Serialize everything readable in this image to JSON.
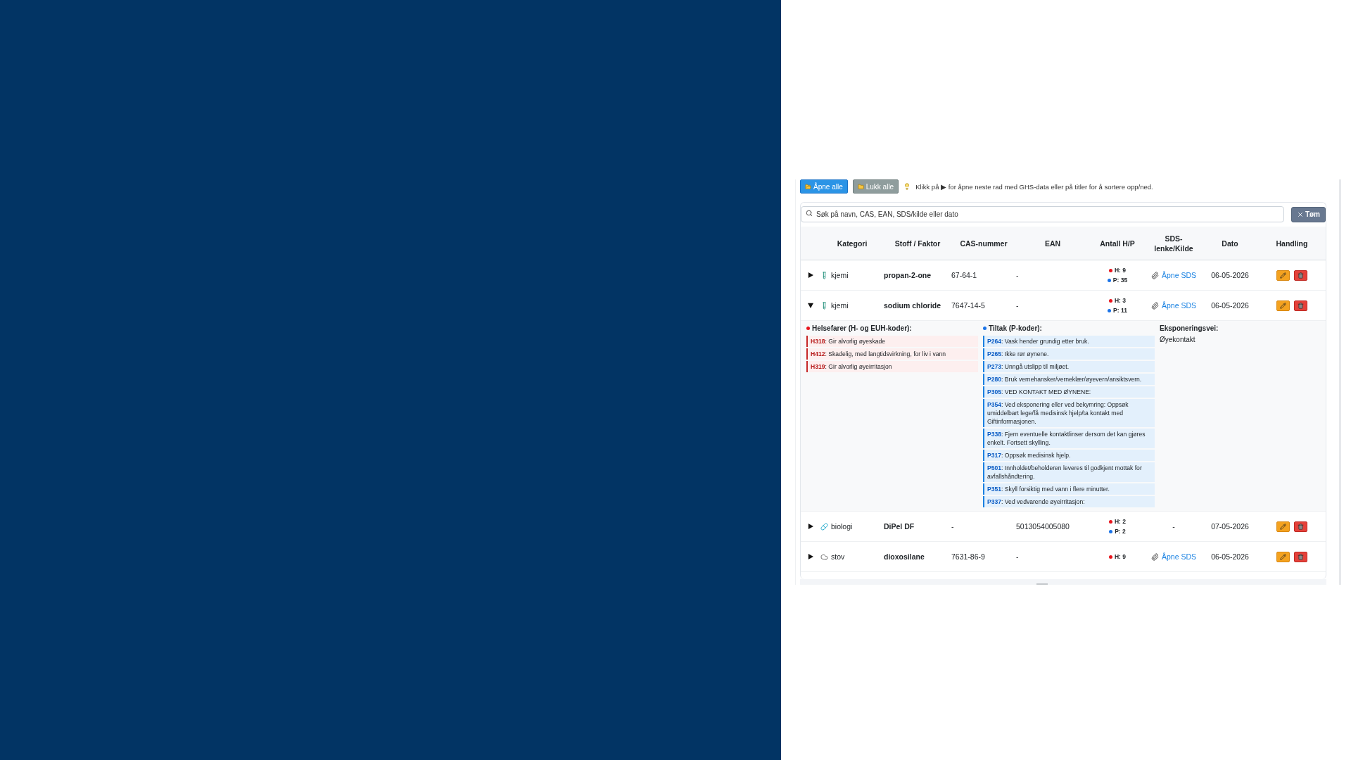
{
  "toolbar": {
    "open_all": "Åpne alle",
    "close_all": "Lukk alle",
    "hint": "Klikk på ▶ for åpne neste rad med GHS-data eller på titler for å sortere opp/ned."
  },
  "search": {
    "placeholder": "Søk på navn, CAS, EAN, SDS/kilde eller dato",
    "clear": "Tøm"
  },
  "table": {
    "columns": [
      "Kategori",
      "Stoff / Faktor",
      "CAS-nummer",
      "EAN",
      "Antall H/P",
      "SDS-lenke/Kilde",
      "Dato",
      "Handling"
    ],
    "rows": [
      {
        "expanded": false,
        "kind": "chemical",
        "category": "kjemi",
        "name": "propan-2-one",
        "cas": "67-64-1",
        "ean": "-",
        "h": "H: 9",
        "p": "P: 35",
        "sds_link": "Åpne SDS",
        "date": "06-05-2026"
      },
      {
        "expanded": true,
        "kind": "chemical",
        "category": "kjemi",
        "name": "sodium chloride",
        "cas": "7647-14-5",
        "ean": "-",
        "h": "H: 3",
        "p": "P: 11",
        "sds_link": "Åpne SDS",
        "date": "06-05-2026",
        "details": {
          "hazards_title": "Helsefarer (H- og EUH-koder):",
          "hazards": [
            "**H318**: Gir alvorlig øyeskade",
            "**H412**: Skadelig, med langtidsvirkning, for liv i vann",
            "**H319**: Gir alvorlig øyeirritasjon"
          ],
          "measures_title": "Tiltak (P-koder):",
          "measures": [
            "**P264**: Vask hender grundig etter bruk.",
            "**P265**: Ikke rør øynene.",
            "**P273**: Unngå utslipp til miljøet.",
            "**P280**: Bruk vernehansker/verneklær/øyevern/ansiktsvern.",
            "**P305**: VED KONTAKT MED ØYNENE:",
            "**P354**: Ved eksponering eller ved bekymring: Oppsøk umiddelbart lege/få medisinsk hjelp/ta kontakt med Giftinformasjonen.",
            "**P338**: Fjern eventuelle kontaktlinser dersom det kan gjøres enkelt. Fortsett skylling.",
            "**P317**: Oppsøk medisinsk hjelp.",
            "**P501**: Innholdet/beholderen leveres til godkjent mottak for avfallshåndtering.",
            "**P351**: Skyll forsiktig med vann i flere minutter.",
            "**P337**: Ved vedvarende øyeirritasjon:"
          ],
          "exposure_title": "Eksponeringsvei:",
          "exposure": "Øyekontakt"
        }
      },
      {
        "expanded": false,
        "kind": "biological",
        "category": "biologi",
        "name": "DiPel DF",
        "cas": "-",
        "ean": "5013054005080",
        "h": "H: 2",
        "p": "P: 2",
        "sds": "-",
        "date": "07-05-2026"
      },
      {
        "expanded": false,
        "kind": "dust",
        "category": "stov",
        "name": "dioxosilane",
        "cas": "7631-86-9",
        "ean": "-",
        "h": "H: 9",
        "sds_link": "Åpne SDS",
        "date": "06-05-2026"
      }
    ]
  }
}
